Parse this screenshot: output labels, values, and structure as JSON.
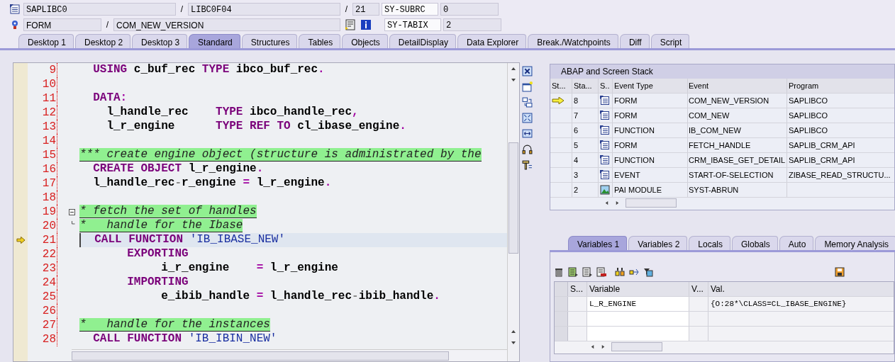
{
  "header": {
    "program": "SAPLIBC0",
    "include": "LIBC0F04",
    "line": "21",
    "event_type": "FORM",
    "event": "COM_NEW_VERSION",
    "separators": [
      "/",
      "/",
      "/"
    ],
    "sys_fields": [
      {
        "name": "SY-SUBRC",
        "value": "0"
      },
      {
        "name": "SY-TABIX",
        "value": "2"
      }
    ]
  },
  "tabs": [
    {
      "label": "Desktop 1",
      "selected": false
    },
    {
      "label": "Desktop 2",
      "selected": false
    },
    {
      "label": "Desktop 3",
      "selected": false
    },
    {
      "label": "Standard",
      "selected": true
    },
    {
      "label": "Structures",
      "selected": false
    },
    {
      "label": "Tables",
      "selected": false
    },
    {
      "label": "Objects",
      "selected": false
    },
    {
      "label": "DetailDisplay",
      "selected": false
    },
    {
      "label": "Data Explorer",
      "selected": false
    },
    {
      "label": "Break./Watchpoints",
      "selected": false
    },
    {
      "label": "Diff",
      "selected": false
    },
    {
      "label": "Script",
      "selected": false
    }
  ],
  "editor": {
    "lines": [
      {
        "no": "9",
        "kind": "code",
        "current": false,
        "tokens": [
          {
            "kind": "kw",
            "text": "  USING"
          },
          {
            "kind": "id",
            "text": " c_buf_rec "
          },
          {
            "kind": "kw",
            "text": "TYPE"
          },
          {
            "kind": "id",
            "text": " ibco_buf_rec"
          },
          {
            "kind": "op",
            "text": "."
          }
        ]
      },
      {
        "no": "10",
        "kind": "code",
        "current": false
      },
      {
        "no": "11",
        "kind": "code",
        "current": false,
        "tokens": [
          {
            "kind": "kw",
            "text": "  DATA"
          },
          {
            "kind": "op",
            "text": ":"
          }
        ]
      },
      {
        "no": "12",
        "kind": "code",
        "current": false,
        "tokens": [
          {
            "kind": "id",
            "text": "    l_handle_rec    "
          },
          {
            "kind": "kw",
            "text": "TYPE"
          },
          {
            "kind": "id",
            "text": " ibco_handle_rec"
          },
          {
            "kind": "op",
            "text": ","
          }
        ]
      },
      {
        "no": "13",
        "kind": "code",
        "current": false,
        "tokens": [
          {
            "kind": "id",
            "text": "    l_r_engine      "
          },
          {
            "kind": "kw",
            "text": "TYPE REF TO"
          },
          {
            "kind": "id",
            "text": " cl_ibase_engine"
          },
          {
            "kind": "op",
            "text": "."
          }
        ]
      },
      {
        "no": "14",
        "kind": "code",
        "current": false
      },
      {
        "no": "15",
        "kind": "comment",
        "current": false,
        "text": "*** create engine object (structure is administrated by the"
      },
      {
        "no": "16",
        "kind": "code",
        "current": false,
        "tokens": [
          {
            "kind": "kw",
            "text": "  CREATE OBJECT"
          },
          {
            "kind": "id",
            "text": " l_r_engine"
          },
          {
            "kind": "op",
            "text": "."
          }
        ]
      },
      {
        "no": "17",
        "kind": "code",
        "current": false,
        "tokens": [
          {
            "kind": "id",
            "text": "  l_handle_rec"
          },
          {
            "kind": "dash",
            "text": "-"
          },
          {
            "kind": "id",
            "text": "r_engine "
          },
          {
            "kind": "op",
            "text": "="
          },
          {
            "kind": "id",
            "text": " l_r_engine"
          },
          {
            "kind": "op",
            "text": "."
          }
        ]
      },
      {
        "no": "18",
        "kind": "code",
        "current": false
      },
      {
        "no": "19",
        "kind": "comment",
        "current": false,
        "expanded": true,
        "text": "* fetch the set of handles"
      },
      {
        "no": "20",
        "kind": "comment",
        "current": false,
        "text": "*   handle for the Ibase"
      },
      {
        "no": "21",
        "kind": "code",
        "current": true,
        "tokens": [
          {
            "kind": "kw",
            "text": "  CALL FUNCTION"
          },
          {
            "kind": "str",
            "text": " 'IB_IBASE_NEW'"
          }
        ]
      },
      {
        "no": "22",
        "kind": "code",
        "current": false,
        "tokens": [
          {
            "kind": "kw",
            "text": "       EXPORTING"
          }
        ]
      },
      {
        "no": "23",
        "kind": "code",
        "current": false,
        "tokens": [
          {
            "kind": "id",
            "text": "            i_r_engine    "
          },
          {
            "kind": "op",
            "text": "="
          },
          {
            "kind": "id",
            "text": " l_r_engine"
          }
        ]
      },
      {
        "no": "24",
        "kind": "code",
        "current": false,
        "tokens": [
          {
            "kind": "kw",
            "text": "       IMPORTING"
          }
        ]
      },
      {
        "no": "25",
        "kind": "code",
        "current": false,
        "tokens": [
          {
            "kind": "id",
            "text": "            e_ibib_handle "
          },
          {
            "kind": "op",
            "text": "="
          },
          {
            "kind": "id",
            "text": " l_handle_rec"
          },
          {
            "kind": "dash",
            "text": "-"
          },
          {
            "kind": "id",
            "text": "ibib_handle"
          },
          {
            "kind": "op",
            "text": "."
          }
        ]
      },
      {
        "no": "26",
        "kind": "code",
        "current": false
      },
      {
        "no": "27",
        "kind": "comment",
        "current": false,
        "text": "*   handle for the instances"
      },
      {
        "no": "28",
        "kind": "code",
        "current": false,
        "tokens": [
          {
            "kind": "kw",
            "text": "  CALL FUNCTION"
          },
          {
            "kind": "str",
            "text": " 'IB_IBIN_NEW'"
          }
        ]
      }
    ]
  },
  "stack": {
    "title": "ABAP and Screen Stack",
    "columns": [
      "St...",
      "Sta...",
      "S..",
      "Event Type",
      "Event",
      "Program"
    ],
    "rows": [
      {
        "current": true,
        "level": "8",
        "kind": "source",
        "event_type": "FORM",
        "event": "COM_NEW_VERSION",
        "program": "SAPLIBCO"
      },
      {
        "current": false,
        "level": "7",
        "kind": "source",
        "event_type": "FORM",
        "event": "COM_NEW",
        "program": "SAPLIBCO"
      },
      {
        "current": false,
        "level": "6",
        "kind": "source",
        "event_type": "FUNCTION",
        "event": "IB_COM_NEW",
        "program": "SAPLIBCO"
      },
      {
        "current": false,
        "level": "5",
        "kind": "source",
        "event_type": "FORM",
        "event": "FETCH_HANDLE",
        "program": "SAPLIB_CRM_API"
      },
      {
        "current": false,
        "level": "4",
        "kind": "source",
        "event_type": "FUNCTION",
        "event": "CRM_IBASE_GET_DETAIL",
        "program": "SAPLIB_CRM_API"
      },
      {
        "current": false,
        "level": "3",
        "kind": "source",
        "event_type": "EVENT",
        "event": "START-OF-SELECTION",
        "program": "ZIBASE_READ_STRUCTU..."
      },
      {
        "current": false,
        "level": "2",
        "kind": "screen",
        "event_type": "PAI MODULE",
        "event": "SYST-ABRUN"
      }
    ]
  },
  "var_tabs": [
    {
      "label": "Variables 1",
      "selected": true
    },
    {
      "label": "Variables 2",
      "selected": false
    },
    {
      "label": "Locals",
      "selected": false
    },
    {
      "label": "Globals",
      "selected": false
    },
    {
      "label": "Auto",
      "selected": false
    },
    {
      "label": "Memory Analysis",
      "selected": false
    }
  ],
  "variables": {
    "columns": [
      "S...",
      "Variable",
      "V...",
      "Val."
    ],
    "rows": [
      {
        "variable": "L_R_ENGINE",
        "value": "{O:28*\\CLASS=CL_IBASE_ENGINE}"
      }
    ]
  }
}
